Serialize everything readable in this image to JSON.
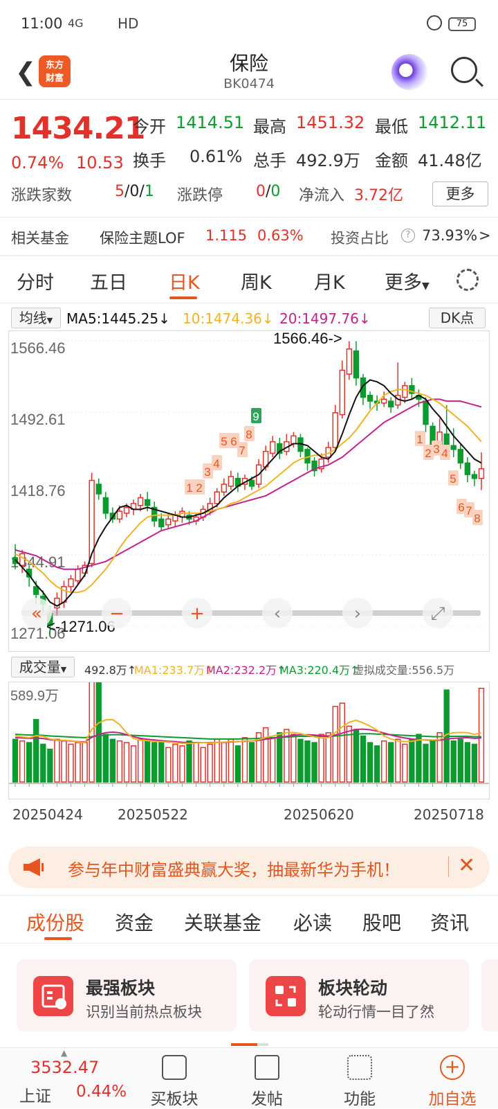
{
  "status": {
    "time": "11:00",
    "signal": "4G",
    "network": "HD",
    "battery": "75"
  },
  "header": {
    "title": "保险",
    "code": "BK0474",
    "logo_line1": "东方",
    "logo_line2": "财富"
  },
  "quote": {
    "price": "1434.21",
    "pct": "0.74%",
    "change": "10.53",
    "open_label": "今开",
    "open": "1414.51",
    "high_label": "最高",
    "high": "1451.32",
    "low_label": "最低",
    "low": "1412.11",
    "turnover_label": "换手",
    "turnover": "0.61%",
    "volume_label": "总手",
    "volume": "492.9万",
    "amount_label": "金额",
    "amount": "41.48亿",
    "breadth_label": "涨跌家数",
    "breadth_up": "5",
    "breadth_flat": "0",
    "breadth_down": "1",
    "sep": "/",
    "limit_label": "涨跌停",
    "limit_up": "0",
    "limit_down": "0",
    "inflow_label": "净流入",
    "inflow": "3.72亿",
    "more": "更多"
  },
  "fund": {
    "label": "相关基金",
    "name": "保险主题LOF",
    "price": "1.115",
    "pct": "0.63%",
    "ratio_label": "投资占比",
    "ratio": "73.93%",
    "ratio_arrow": ">"
  },
  "tabs": [
    "分时",
    "五日",
    "日K",
    "周K",
    "月K",
    "更多"
  ],
  "ma": {
    "selector": "均线",
    "ma5": "MA5:1445.25",
    "ma10": "10:1474.36",
    "ma20": "20:1497.76",
    "dk": "DK点",
    "down": "↓"
  },
  "chart_labels": {
    "y1": "1566.46",
    "y2": "1492.61",
    "y3": "1418.76",
    "y4": "1344.91",
    "y5": "1271.06",
    "max_label": "1566.46->",
    "min_label": "<-1271.06",
    "toolbar": [
      "«",
      "−",
      "+",
      "‹",
      "›",
      "⤢"
    ]
  },
  "td_marks": [
    {
      "t": "1",
      "x": 274,
      "y": 704
    },
    {
      "t": "2",
      "x": 288,
      "y": 704
    },
    {
      "t": "3",
      "x": 300,
      "y": 681
    },
    {
      "t": "4",
      "x": 313,
      "y": 669
    },
    {
      "t": "5",
      "x": 324,
      "y": 637
    },
    {
      "t": "6",
      "x": 338,
      "y": 637
    },
    {
      "t": "7",
      "x": 350,
      "y": 650
    },
    {
      "t": "8",
      "x": 360,
      "y": 627
    },
    {
      "t": "9",
      "x": 370,
      "y": 601,
      "green": true
    },
    {
      "t": "1",
      "x": 607,
      "y": 634
    },
    {
      "t": "2",
      "x": 619,
      "y": 654
    },
    {
      "t": "3",
      "x": 631,
      "y": 648
    },
    {
      "t": "4",
      "x": 643,
      "y": 654
    },
    {
      "t": "5",
      "x": 655,
      "y": 691
    },
    {
      "t": "6",
      "x": 667,
      "y": 732
    },
    {
      "t": "7",
      "x": 678,
      "y": 737
    },
    {
      "t": "8",
      "x": 690,
      "y": 748
    }
  ],
  "volume": {
    "selector": "成交量",
    "value": "492.8万",
    "ma1": "MA1:233.7万",
    "ma2": "MA2:232.2万",
    "ma3": "MA3:220.4万",
    "virtual": "虚拟成交量:556.5万",
    "axis_max": "589.9万",
    "up": "↑"
  },
  "dates": [
    "20250424",
    "20250522",
    "20250620",
    "20250718"
  ],
  "banner": {
    "text": "参与年中财富盛典赢大奖，抽最新华为手机！",
    "close": "✕"
  },
  "bottom_tabs": [
    "成份股",
    "资金",
    "关联基金",
    "必读",
    "股吧",
    "资讯"
  ],
  "cards": [
    {
      "title": "最强板块",
      "sub": "识别当前热点板块"
    },
    {
      "title": "板块轮动",
      "sub": "轮动行情一目了然"
    }
  ],
  "nav": {
    "index_value": "3532.47",
    "index_name": "上证",
    "index_pct": "0.44%",
    "items": [
      "买板块",
      "发帖",
      "功能",
      "加自选"
    ]
  },
  "colors": {
    "up": "#e0312a",
    "down": "#0b9b2f",
    "accent": "#e8561f",
    "ma5": "#111111",
    "ma10": "#f0b323",
    "ma20": "#c0238b"
  },
  "chart_data": {
    "type": "candlestick",
    "ylim": [
      1271.06,
      1566.46
    ],
    "candles": [
      [
        1342,
        1336,
        1356,
        1330
      ],
      [
        1334,
        1346,
        1350,
        1326
      ],
      [
        1330,
        1322,
        1334,
        1312
      ],
      [
        1312,
        1304,
        1318,
        1294
      ],
      [
        1302,
        1294,
        1308,
        1286
      ],
      [
        1284,
        1272,
        1292,
        1262
      ],
      [
        1290,
        1300,
        1306,
        1282
      ],
      [
        1296,
        1312,
        1318,
        1290
      ],
      [
        1312,
        1320,
        1324,
        1306
      ],
      [
        1318,
        1330,
        1334,
        1314
      ],
      [
        1326,
        1334,
        1338,
        1322
      ],
      [
        1336,
        1422,
        1430,
        1332
      ],
      [
        1418,
        1408,
        1424,
        1402
      ],
      [
        1404,
        1388,
        1410,
        1382
      ],
      [
        1388,
        1382,
        1394,
        1378
      ],
      [
        1382,
        1390,
        1396,
        1378
      ],
      [
        1388,
        1394,
        1398,
        1384
      ],
      [
        1392,
        1398,
        1402,
        1386
      ],
      [
        1396,
        1404,
        1408,
        1390
      ],
      [
        1402,
        1396,
        1410,
        1390
      ],
      [
        1394,
        1380,
        1400,
        1374
      ],
      [
        1382,
        1374,
        1388,
        1370
      ],
      [
        1376,
        1382,
        1388,
        1372
      ],
      [
        1380,
        1386,
        1390,
        1374
      ],
      [
        1384,
        1390,
        1394,
        1378
      ],
      [
        1386,
        1382,
        1390,
        1376
      ],
      [
        1380,
        1384,
        1388,
        1376
      ],
      [
        1384,
        1392,
        1396,
        1380
      ],
      [
        1390,
        1398,
        1404,
        1386
      ],
      [
        1398,
        1410,
        1414,
        1394
      ],
      [
        1410,
        1418,
        1424,
        1406
      ],
      [
        1416,
        1426,
        1432,
        1412
      ],
      [
        1424,
        1416,
        1430,
        1410
      ],
      [
        1418,
        1424,
        1428,
        1412
      ],
      [
        1422,
        1416,
        1426,
        1412
      ],
      [
        1418,
        1438,
        1444,
        1414
      ],
      [
        1436,
        1452,
        1458,
        1432
      ],
      [
        1450,
        1462,
        1468,
        1446
      ],
      [
        1460,
        1450,
        1466,
        1444
      ],
      [
        1452,
        1462,
        1470,
        1448
      ],
      [
        1460,
        1468,
        1472,
        1456
      ],
      [
        1466,
        1452,
        1470,
        1446
      ],
      [
        1454,
        1440,
        1456,
        1432
      ],
      [
        1442,
        1432,
        1446,
        1426
      ],
      [
        1434,
        1444,
        1450,
        1430
      ],
      [
        1446,
        1456,
        1462,
        1440
      ],
      [
        1456,
        1492,
        1500,
        1452
      ],
      [
        1490,
        1536,
        1546,
        1486
      ],
      [
        1532,
        1558,
        1566,
        1526
      ],
      [
        1556,
        1528,
        1566,
        1520
      ],
      [
        1528,
        1508,
        1532,
        1500
      ],
      [
        1510,
        1504,
        1514,
        1496
      ],
      [
        1504,
        1502,
        1510,
        1494
      ],
      [
        1502,
        1506,
        1514,
        1498
      ],
      [
        1504,
        1498,
        1508,
        1492
      ],
      [
        1500,
        1510,
        1544,
        1496
      ],
      [
        1508,
        1520,
        1524,
        1502
      ],
      [
        1520,
        1512,
        1528,
        1506
      ],
      [
        1510,
        1506,
        1516,
        1498
      ],
      [
        1504,
        1480,
        1508,
        1472
      ],
      [
        1478,
        1456,
        1482,
        1450
      ],
      [
        1458,
        1472,
        1486,
        1452
      ],
      [
        1470,
        1458,
        1500,
        1452
      ],
      [
        1458,
        1454,
        1476,
        1446
      ],
      [
        1454,
        1440,
        1460,
        1434
      ],
      [
        1440,
        1428,
        1446,
        1420
      ],
      [
        1428,
        1424,
        1432,
        1416
      ],
      [
        1424,
        1434,
        1451,
        1412
      ]
    ],
    "ma5": [
      1340,
      1332,
      1324,
      1314,
      1306,
      1296,
      1292,
      1296,
      1304,
      1314,
      1324,
      1346,
      1362,
      1374,
      1384,
      1394,
      1396,
      1392,
      1392,
      1394,
      1392,
      1390,
      1388,
      1386,
      1384,
      1384,
      1386,
      1388,
      1392,
      1396,
      1404,
      1410,
      1416,
      1420,
      1424,
      1428,
      1436,
      1444,
      1452,
      1456,
      1460,
      1460,
      1458,
      1452,
      1446,
      1444,
      1452,
      1470,
      1490,
      1508,
      1520,
      1526,
      1524,
      1520,
      1512,
      1506,
      1504,
      1506,
      1510,
      1506,
      1496,
      1488,
      1478,
      1468,
      1460,
      1452,
      1444,
      1440
    ],
    "ma10": [
      1346,
      1342,
      1338,
      1332,
      1326,
      1318,
      1312,
      1308,
      1306,
      1306,
      1308,
      1314,
      1322,
      1330,
      1340,
      1352,
      1362,
      1370,
      1378,
      1384,
      1386,
      1386,
      1386,
      1386,
      1388,
      1388,
      1388,
      1388,
      1390,
      1392,
      1394,
      1398,
      1400,
      1404,
      1408,
      1412,
      1416,
      1422,
      1428,
      1434,
      1440,
      1444,
      1446,
      1448,
      1448,
      1450,
      1454,
      1460,
      1466,
      1474,
      1484,
      1494,
      1502,
      1510,
      1514,
      1516,
      1516,
      1514,
      1512,
      1510,
      1506,
      1502,
      1496,
      1490,
      1484,
      1478,
      1470,
      1462
    ],
    "ma20": [
      1350,
      1348,
      1346,
      1344,
      1340,
      1336,
      1332,
      1330,
      1330,
      1330,
      1332,
      1334,
      1336,
      1338,
      1342,
      1346,
      1350,
      1354,
      1358,
      1362,
      1366,
      1370,
      1372,
      1374,
      1376,
      1378,
      1380,
      1384,
      1388,
      1392,
      1394,
      1396,
      1398,
      1400,
      1402,
      1404,
      1406,
      1410,
      1414,
      1418,
      1422,
      1426,
      1430,
      1434,
      1436,
      1438,
      1442,
      1446,
      1452,
      1458,
      1464,
      1470,
      1476,
      1482,
      1486,
      1490,
      1494,
      1498,
      1502,
      1504,
      1506,
      1506,
      1504,
      1504,
      1504,
      1502,
      1500,
      1498
    ],
    "volume_ylim": [
      0,
      589.9
    ],
    "volumes": [
      260,
      250,
      240,
      380,
      230,
      200,
      260,
      250,
      230,
      240,
      240,
      760,
      620,
      290,
      260,
      250,
      240,
      220,
      260,
      250,
      240,
      250,
      210,
      230,
      220,
      250,
      240,
      210,
      230,
      260,
      240,
      260,
      220,
      270,
      240,
      300,
      330,
      270,
      300,
      320,
      290,
      260,
      250,
      240,
      290,
      300,
      460,
      480,
      340,
      320,
      280,
      240,
      220,
      250,
      240,
      260,
      230,
      260,
      290,
      230,
      250,
      300,
      560,
      250,
      260,
      240,
      230,
      570
    ],
    "vol_ma1": [
      280,
      275,
      270,
      282,
      278,
      262,
      255,
      254,
      252,
      244,
      240,
      320,
      360,
      378,
      380,
      350,
      300,
      265,
      255,
      252,
      248,
      246,
      243,
      240,
      235,
      235,
      238,
      240,
      238,
      240,
      243,
      247,
      245,
      250,
      250,
      258,
      272,
      280,
      290,
      300,
      302,
      295,
      285,
      275,
      268,
      270,
      300,
      336,
      364,
      376,
      360,
      340,
      316,
      280,
      262,
      250,
      246,
      248,
      256,
      258,
      256,
      258,
      290,
      300,
      302,
      300,
      290,
      300
    ],
    "vol_ma2": [
      270,
      268,
      266,
      268,
      265,
      258,
      254,
      252,
      250,
      246,
      244,
      272,
      290,
      300,
      304,
      300,
      288,
      276,
      266,
      260,
      256,
      252,
      248,
      246,
      242,
      240,
      240,
      240,
      240,
      240,
      242,
      244,
      246,
      248,
      250,
      254,
      260,
      266,
      272,
      278,
      284,
      288,
      288,
      286,
      282,
      280,
      286,
      298,
      310,
      320,
      322,
      318,
      310,
      298,
      286,
      276,
      268,
      262,
      258,
      256,
      254,
      254,
      262,
      266,
      268,
      270,
      266,
      268
    ],
    "vol_ma3": [
      290,
      288,
      286,
      286,
      284,
      280,
      278,
      276,
      274,
      272,
      270,
      276,
      282,
      286,
      288,
      288,
      286,
      284,
      282,
      280,
      278,
      276,
      274,
      272,
      270,
      268,
      266,
      264,
      262,
      262,
      262,
      262,
      262,
      264,
      264,
      266,
      268,
      270,
      272,
      274,
      276,
      278,
      278,
      278,
      278,
      278,
      280,
      284,
      288,
      292,
      294,
      294,
      292,
      290,
      288,
      286,
      284,
      282,
      280,
      278,
      276,
      276,
      278,
      278,
      278,
      278,
      276,
      276
    ]
  }
}
